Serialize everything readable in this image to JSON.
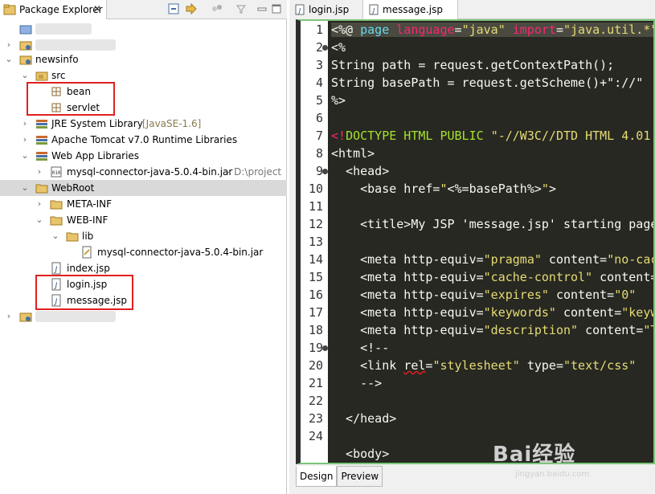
{
  "explorer": {
    "title": "Package Explorer",
    "close": "✕"
  },
  "tree": {
    "project": "newsinfo",
    "src": "src",
    "bean": "bean",
    "servlet": "servlet",
    "jre_label": "JRE System Library",
    "jre_decoration": "[JavaSE-1.6]",
    "tomcat": "Apache Tomcat v7.0 Runtime Libraries",
    "webapp_libs": "Web App Libraries",
    "mysql_jar": "mysql-connector-java-5.0.4-bin.jar",
    "mysql_jar_path": "- D:\\project",
    "webroot": "WebRoot",
    "meta_inf": "META-INF",
    "web_inf": "WEB-INF",
    "lib": "lib",
    "lib_jar": "mysql-connector-java-5.0.4-bin.jar",
    "index": "index.jsp",
    "login": "login.jsp",
    "message": "message.jsp"
  },
  "editor": {
    "tabs": [
      "login.jsp",
      "message.jsp"
    ],
    "bottom_tabs": [
      "Design",
      "Preview"
    ],
    "line_numbers": [
      "1",
      "2",
      "3",
      "4",
      "5",
      "6",
      "7",
      "8",
      "9",
      "10",
      "11",
      "12",
      "13",
      "14",
      "15",
      "16",
      "17",
      "18",
      "19",
      "20",
      "21",
      "22",
      "23",
      "24"
    ]
  },
  "watermark": {
    "brand": "Bai经验",
    "url": "jingyan.baidu.com"
  },
  "colors": {
    "editor_bg": "#272822",
    "tag": "#f92672",
    "string": "#e6db74",
    "attr": "#a6e22e",
    "highlight_box": "#e02020"
  }
}
